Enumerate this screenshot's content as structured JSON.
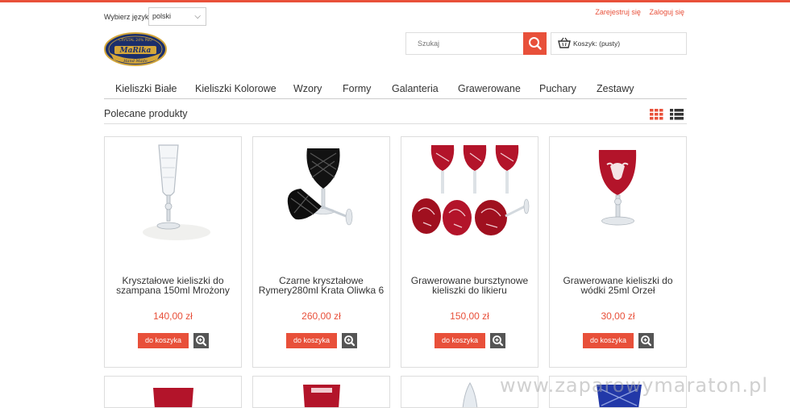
{
  "language": {
    "label": "Wybierz język",
    "selected": "polski"
  },
  "auth": {
    "register": "Zarejestruj się",
    "login": "Zaloguj się"
  },
  "logo": {
    "top_text": "CRYSTAL 24% PbO",
    "name": "MaRika",
    "bottom_text": "Hand Made"
  },
  "search": {
    "placeholder": "Szukaj"
  },
  "cart": {
    "label": "Koszyk: (pusty)"
  },
  "nav": [
    "Kieliszki Białe",
    "Kieliszki Kolorowe",
    "Wzory",
    "Formy",
    "Galanteria",
    "Grawerowane",
    "Puchary",
    "Zestawy"
  ],
  "section": {
    "title": "Polecane produkty"
  },
  "products": [
    {
      "name": "Kryształowe kieliszki do szampana 150ml Mrożony",
      "price": "140,00 zł",
      "add": "do koszyka"
    },
    {
      "name": "Czarne kryształowe Rymery280ml Krata Oliwka 6",
      "price": "260,00 zł",
      "add": "do koszyka"
    },
    {
      "name": "Grawerowane bursztynowe kieliszki do likieru",
      "price": "150,00 zł",
      "add": "do koszyka"
    },
    {
      "name": "Grawerowane kieliszki do wódki 25ml Orzeł",
      "price": "30,00 zł",
      "add": "do koszyka"
    }
  ],
  "watermark": "www.zaparowymaraton.pl",
  "colors": {
    "accent": "#e8503a",
    "icon_dark": "#555555",
    "ruby": "#b3142a",
    "black_glass": "#111111",
    "cobalt": "#2238a8"
  },
  "icons": {
    "search": "search-icon",
    "cart": "basket-icon",
    "zoom": "zoom-icon",
    "grid": "grid-view-icon",
    "list": "list-view-icon",
    "chevron": "chevron-down-icon"
  }
}
